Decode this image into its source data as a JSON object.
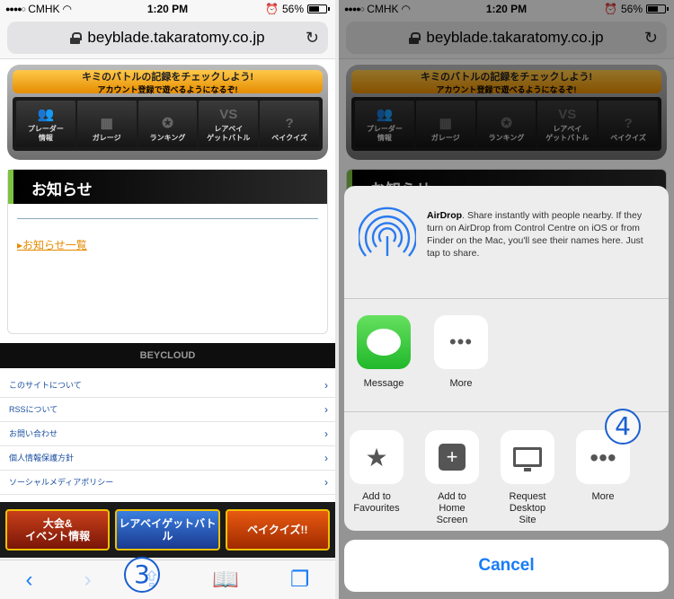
{
  "status_bar": {
    "carrier": "CMHK",
    "time": "1:20 PM",
    "battery": "56%"
  },
  "browser": {
    "url": "beyblade.takaratomy.co.jp"
  },
  "page": {
    "banner_title": "キミのバトルの記録をチェックしよう!",
    "banner_subtitle": "アカウント登録で遊べるようになるぞ!",
    "banner_tiles": [
      {
        "label": "プレーダー\n情報",
        "icon": "players-icon"
      },
      {
        "label": "ガレージ",
        "icon": "garage-icon"
      },
      {
        "label": "ランキング",
        "icon": "ranking-icon"
      },
      {
        "label": "レアベイ\nゲットバトル",
        "icon": "vs-icon"
      },
      {
        "label": "ベイクイズ",
        "icon": "question-icon"
      }
    ],
    "news_heading": "お知らせ",
    "news_link": "お知らせ一覧",
    "footer_brand": "BEYCLOUD",
    "footer_links": [
      "このサイトについて",
      "RSSについて",
      "お問い合わせ",
      "個人情報保護方針",
      "ソーシャルメディアポリシー"
    ],
    "game_banners": [
      "大会&\nイベント情報",
      "レアベイゲットバトル",
      "ベイクイズ!!"
    ]
  },
  "annotations": {
    "left_step": "3",
    "right_step": "4"
  },
  "share_sheet": {
    "airdrop_title": "AirDrop",
    "airdrop_text": "Share instantly with people nearby. If they turn on AirDrop from Control Centre on iOS or from Finder on the Mac, you'll see their names here. Just tap to share.",
    "apps": [
      {
        "label": "Message",
        "icon": "message-icon"
      },
      {
        "label": "More",
        "icon": "more-icon"
      }
    ],
    "actions": [
      {
        "label": "Add to Favourites",
        "icon": "star-icon"
      },
      {
        "label": "Add to Home Screen",
        "icon": "plus-square-icon"
      },
      {
        "label": "Request Desktop Site",
        "icon": "desktop-icon"
      },
      {
        "label": "More",
        "icon": "more-icon"
      }
    ],
    "cancel_label": "Cancel"
  }
}
